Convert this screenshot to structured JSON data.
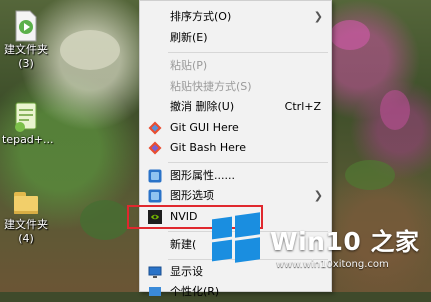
{
  "desktop": {
    "icons": [
      {
        "label_line1": "建文件夹",
        "label_line2": "(3)"
      },
      {
        "label_line1": "tepad+..."
      },
      {
        "label_line1": "建文件夹",
        "label_line2": "(4)"
      }
    ]
  },
  "context_menu": {
    "items": [
      {
        "label": "排序方式(O)",
        "has_submenu": true
      },
      {
        "label": "刷新(E)"
      },
      {
        "label": "粘贴(P)",
        "disabled": true
      },
      {
        "label": "粘贴快捷方式(S)",
        "disabled": true
      },
      {
        "label": "撤消 删除(U)",
        "shortcut": "Ctrl+Z"
      },
      {
        "label": "Git GUI Here",
        "icon": "git-gui-icon"
      },
      {
        "label": "Git Bash Here",
        "icon": "git-bash-icon"
      },
      {
        "label": "图形属性......",
        "icon": "graphics-properties-icon"
      },
      {
        "label": "图形选项",
        "icon": "graphics-options-icon",
        "has_submenu": true
      },
      {
        "label": "NVID",
        "icon": "nvidia-icon"
      },
      {
        "label": "新建("
      },
      {
        "label": "显示设",
        "icon": "display-settings-icon"
      },
      {
        "label": "个性化(R)",
        "icon": "personalize-icon"
      }
    ]
  },
  "watermark": {
    "brand_latin": "Win10",
    "brand_cjk": "之家",
    "url": "www.win10xitong.com"
  },
  "colors": {
    "highlight_border": "#e0282e",
    "windows_blue": "#1a8ee0"
  }
}
